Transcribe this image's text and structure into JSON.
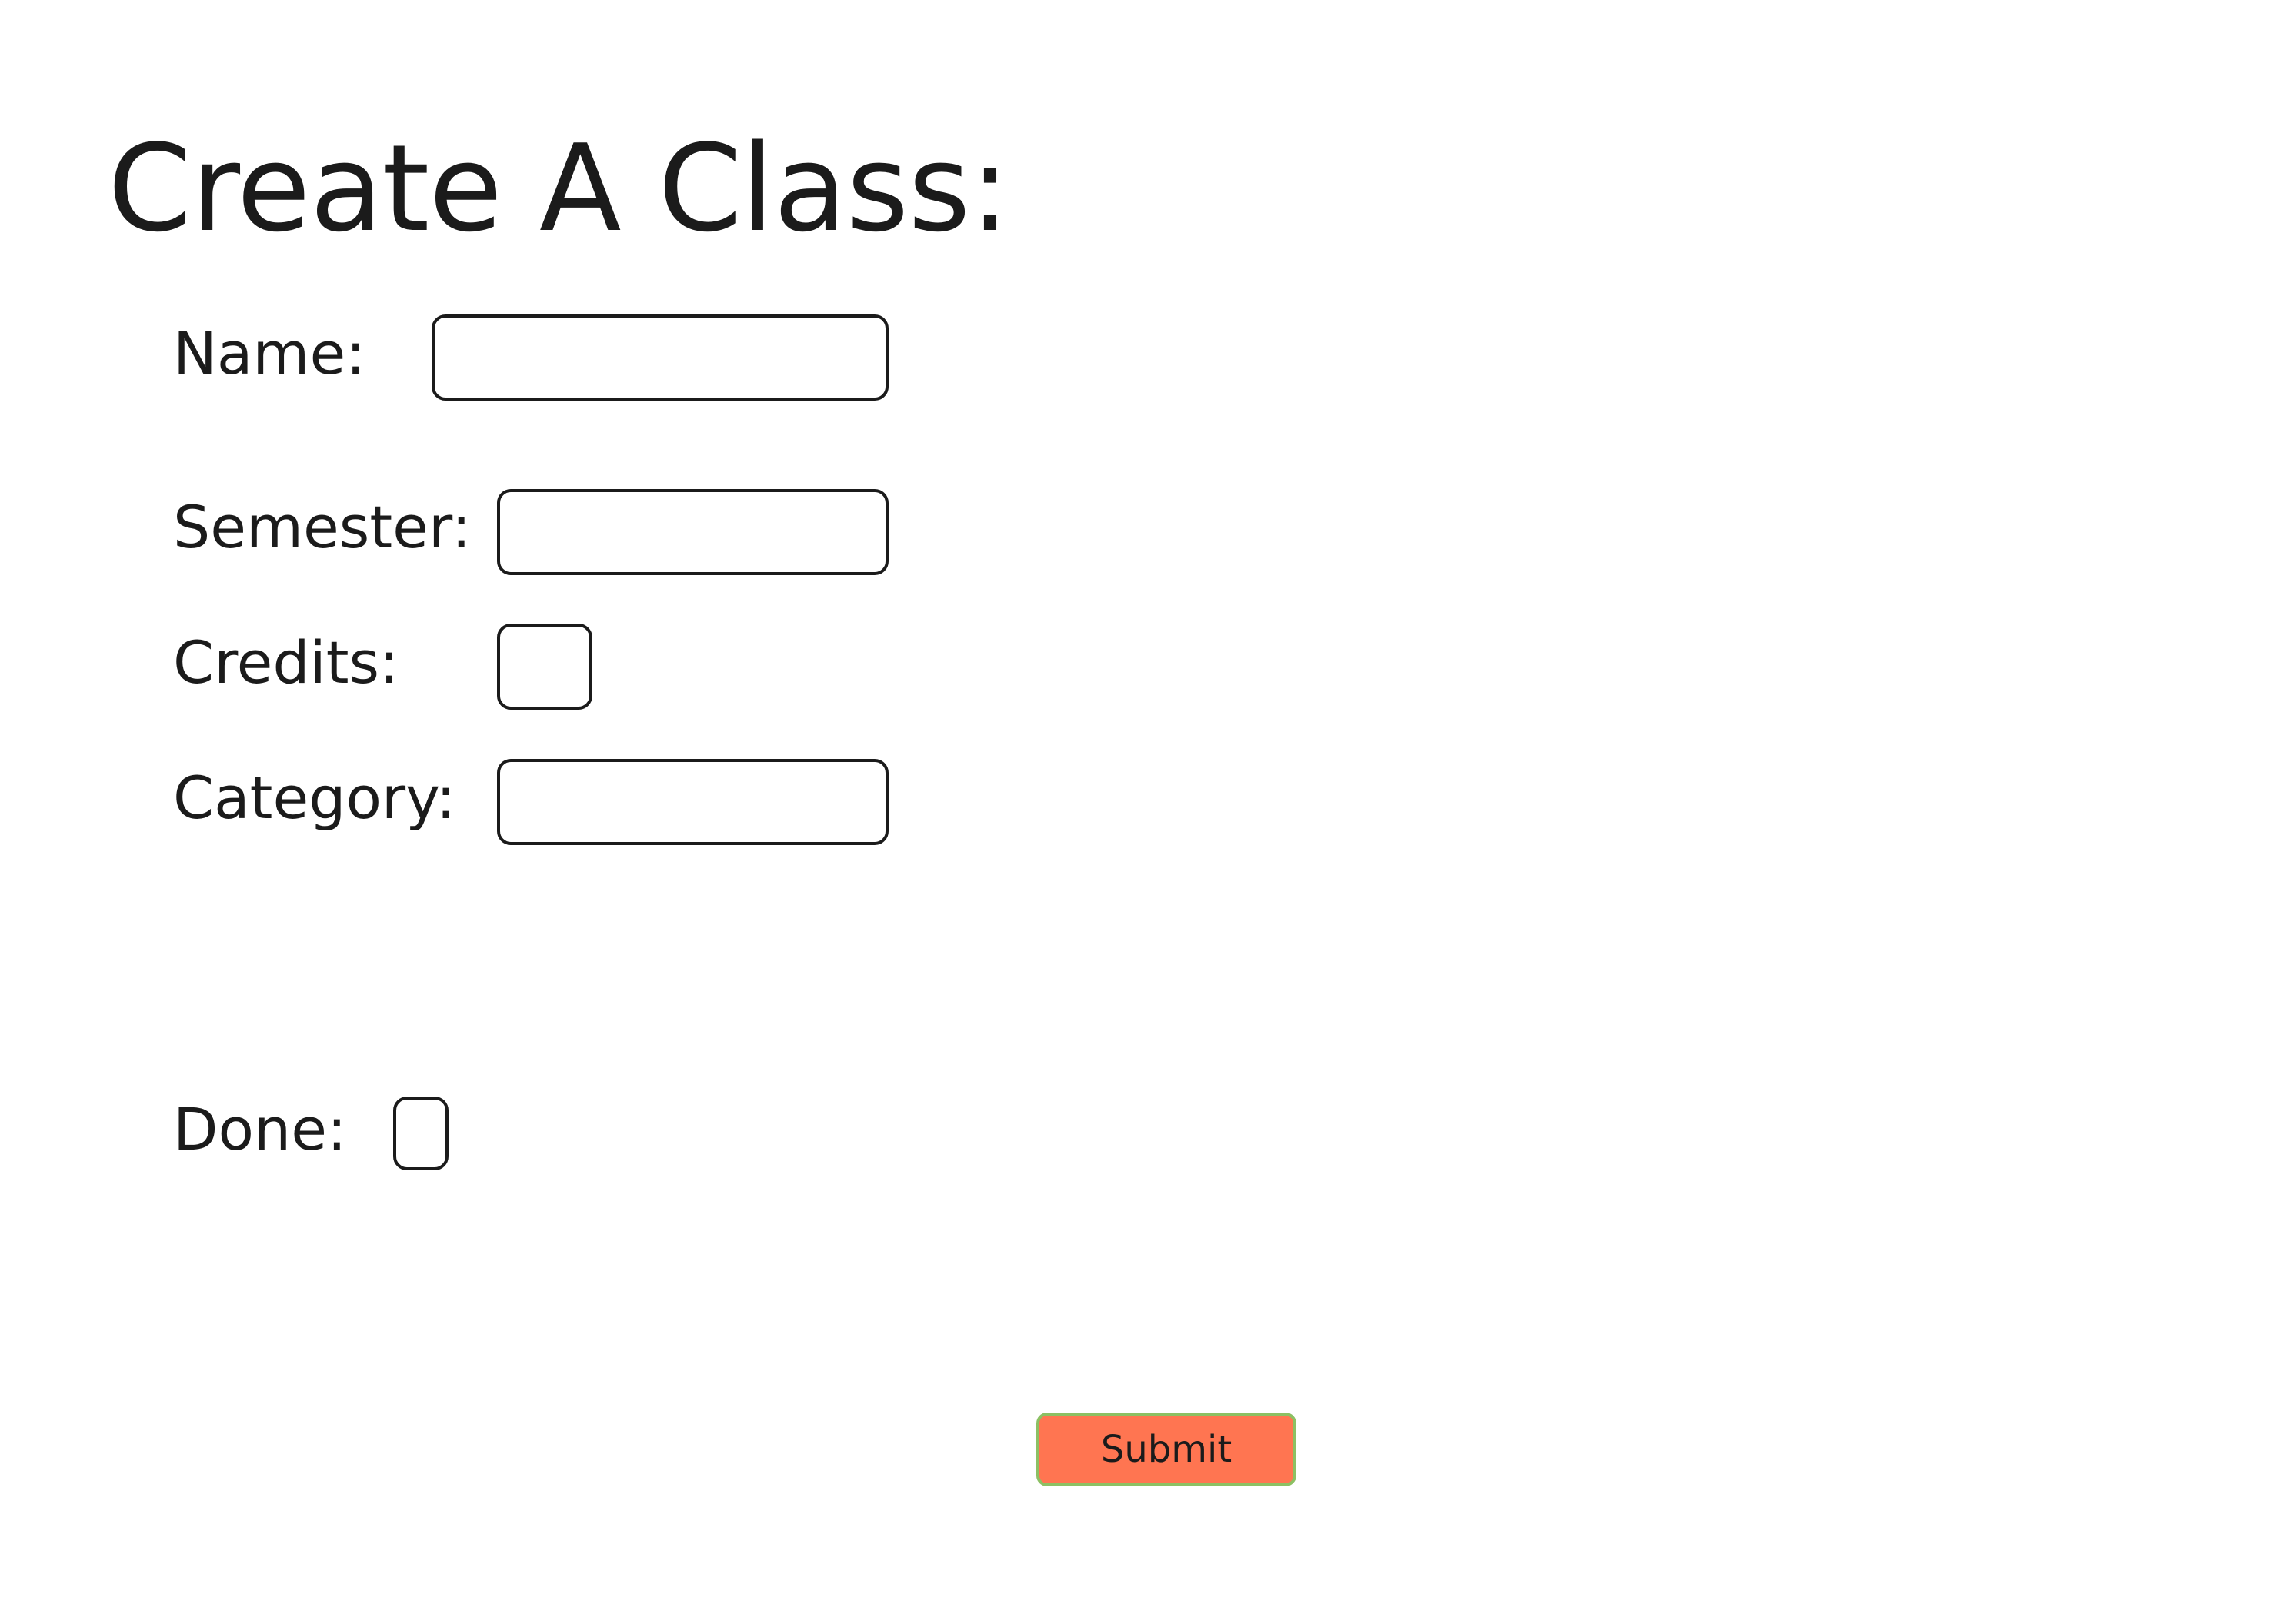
{
  "form": {
    "title": "Create A Class:",
    "name": {
      "label": "Name:",
      "value": ""
    },
    "semester": {
      "label": "Semester:",
      "value": ""
    },
    "credits": {
      "label": "Credits:",
      "value": ""
    },
    "category": {
      "label": "Category:",
      "value": ""
    },
    "done": {
      "label": "Done:",
      "value": ""
    },
    "submit_label": "Submit"
  },
  "colors": {
    "submit_background": "#ff7551",
    "submit_border": "#8cc063",
    "text": "#1b1b1b",
    "background": "#ffffff"
  }
}
